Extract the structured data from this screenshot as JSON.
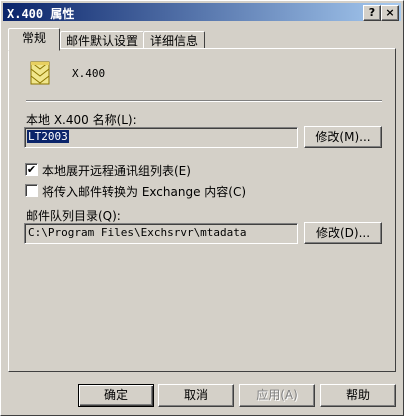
{
  "window": {
    "title": "X.400 属性",
    "help_btn": "?",
    "close_btn": "×"
  },
  "tabs": [
    {
      "label": "常规",
      "active": true
    },
    {
      "label": "邮件默认设置",
      "active": false
    },
    {
      "label": "详细信息",
      "active": false
    }
  ],
  "header": {
    "name": "X.400",
    "icon": "x400-connector-icon"
  },
  "local_name": {
    "label": "本地 X.400 名称(L):",
    "value": "LT2003",
    "modify_label": "修改(M)..."
  },
  "options": {
    "expand_dl": {
      "label": "本地展开远程通讯组列表(E)",
      "checked": true
    },
    "convert": {
      "label": "将传入邮件转换为 Exchange 内容(C)",
      "checked": false
    }
  },
  "queue": {
    "label": "邮件队列目录(Q):",
    "value": "C:\\Program Files\\Exchsrvr\\mtadata",
    "modify_label": "修改(D)..."
  },
  "buttons": {
    "ok": "确定",
    "cancel": "取消",
    "apply": "应用(A)",
    "help": "帮助"
  },
  "check_mark": "✔"
}
